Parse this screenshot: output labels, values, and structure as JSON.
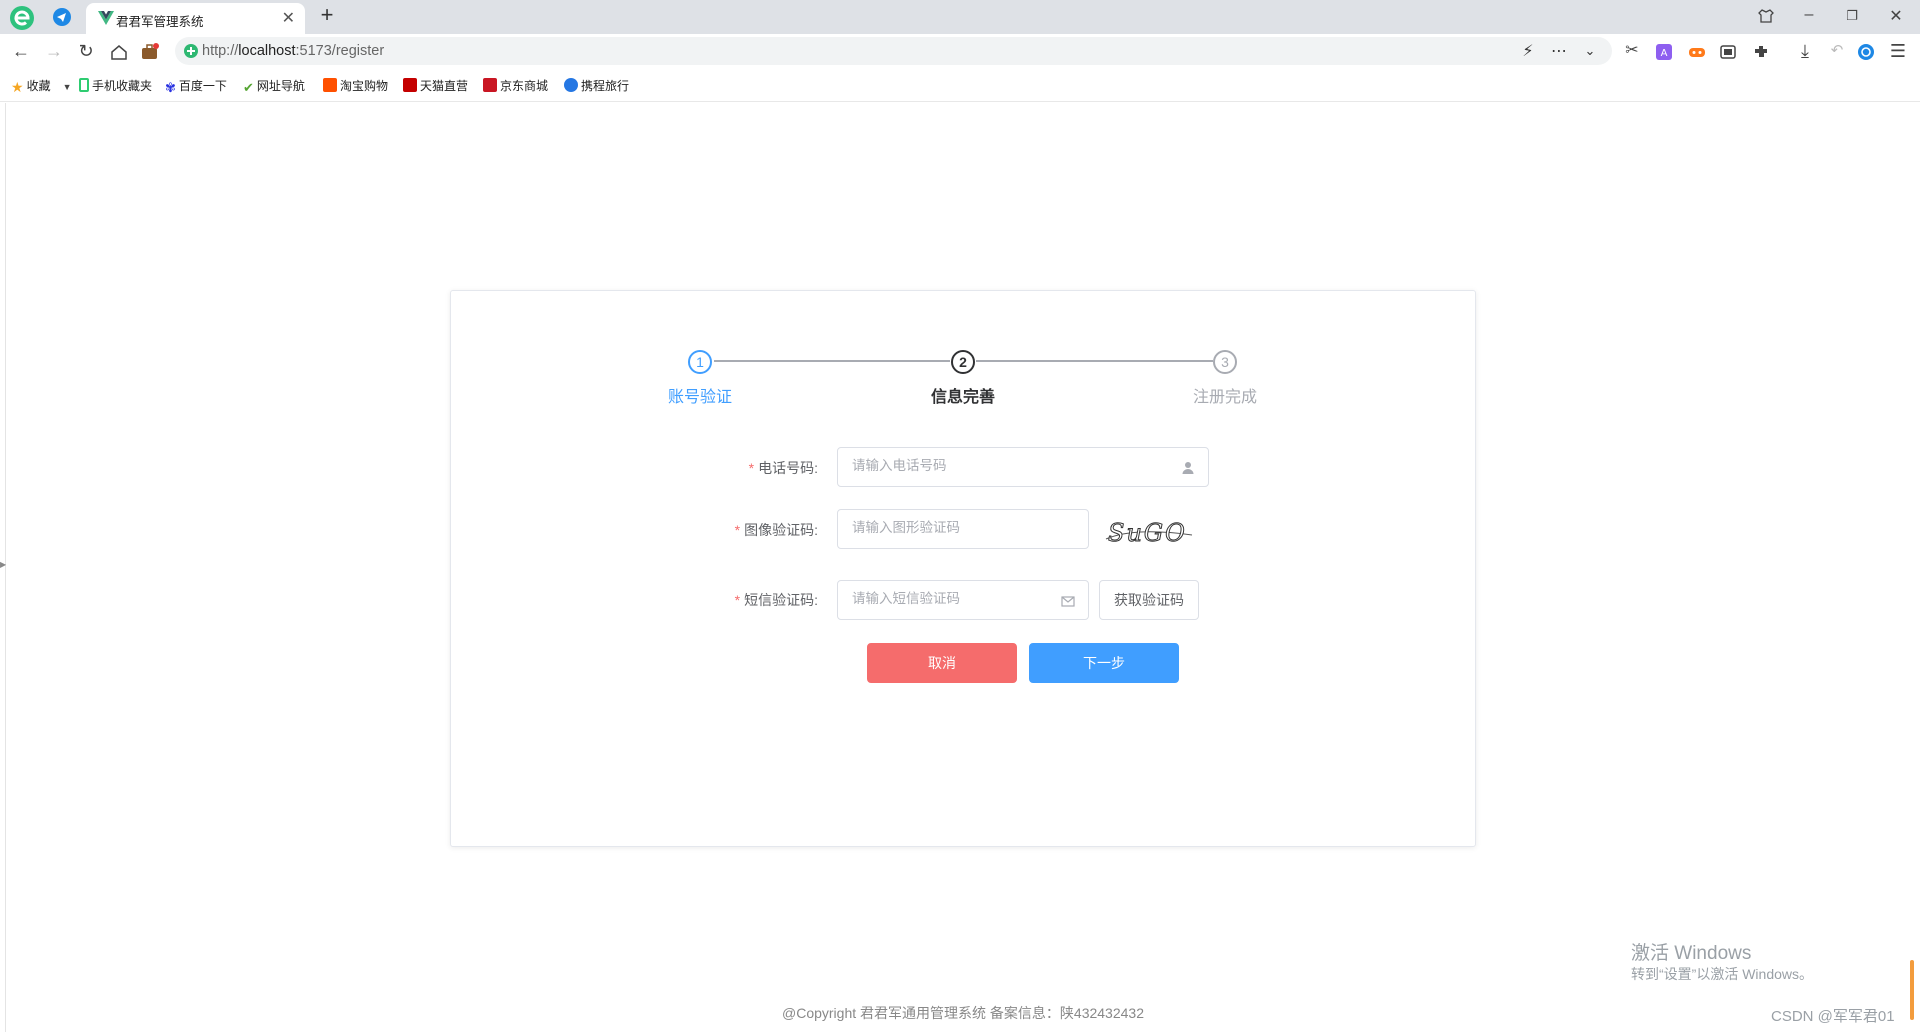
{
  "browser": {
    "tab_title": "君君军管理系统",
    "url_prefix": "http://",
    "url_host": "localhost",
    "url_rest": ":5173/register"
  },
  "bookmarks": [
    {
      "label": "收藏",
      "icon": "star-icon",
      "color": "#f5a623"
    },
    {
      "label": "手机收藏夹",
      "icon": "phone-icon",
      "color": "#2ecc71"
    },
    {
      "label": "百度一下",
      "icon": "baidu-paw-icon",
      "color": "#2932e1"
    },
    {
      "label": "网址导航",
      "icon": "hao123-icon",
      "color": "#55a532"
    },
    {
      "label": "淘宝购物",
      "icon": "taobao-icon",
      "color": "#ff5000"
    },
    {
      "label": "天猫直营",
      "icon": "tmall-icon",
      "color": "#c40000"
    },
    {
      "label": "京东商城",
      "icon": "jd-icon",
      "color": "#c91623"
    },
    {
      "label": "携程旅行",
      "icon": "ctrip-icon",
      "color": "#2577e3"
    }
  ],
  "steps": [
    {
      "number": "1",
      "label": "账号验证",
      "state": "done",
      "color": "#409eff"
    },
    {
      "number": "2",
      "label": "信息完善",
      "state": "process",
      "color": "#303133"
    },
    {
      "number": "3",
      "label": "注册完成",
      "state": "wait",
      "color": "#a8abb2"
    }
  ],
  "form": {
    "phone": {
      "label": "电话号码:",
      "placeholder": "请输入电话号码"
    },
    "captcha": {
      "label": "图像验证码:",
      "placeholder": "请输入图形验证码",
      "captcha_text": "SuGO"
    },
    "sms": {
      "label": "短信验证码:",
      "placeholder": "请输入短信验证码",
      "get_code_label": "获取验证码"
    },
    "cancel_label": "取消",
    "next_label": "下一步"
  },
  "footer": "@Copyright 君君军通用管理系统 备案信息：陕432432432",
  "overlay": {
    "win_activate_title": "激活 Windows",
    "win_activate_sub": "转到“设置”以激活 Windows。",
    "watermark": "CSDN @军军君01"
  },
  "colors": {
    "primary": "#409eff",
    "danger": "#f56c6c",
    "required": "#f56c6c"
  }
}
